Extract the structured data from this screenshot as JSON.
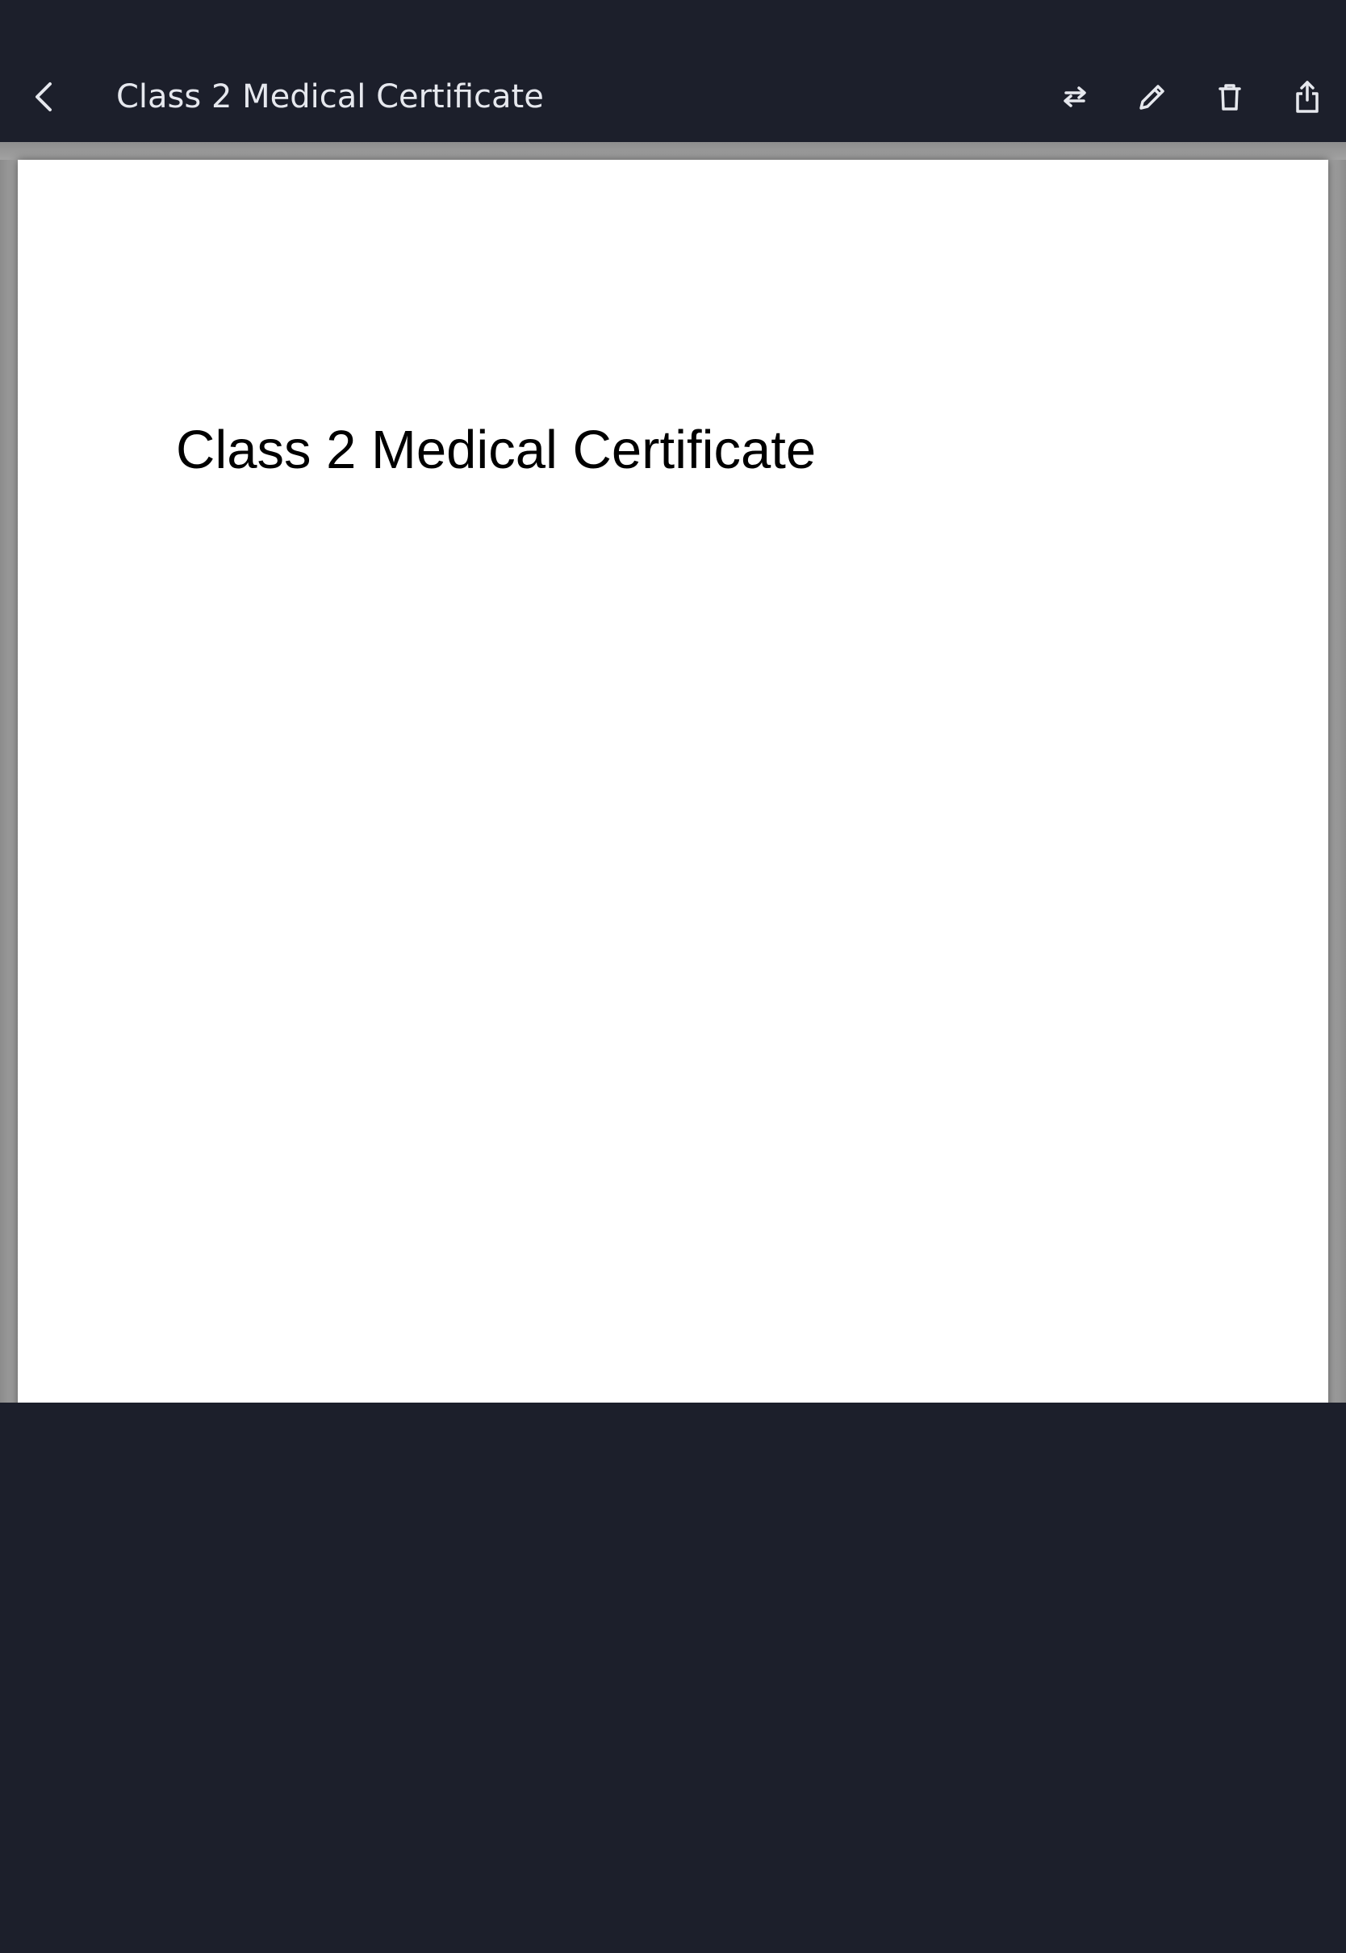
{
  "app_bar": {
    "title": "Class 2 Medical Certificate",
    "back_icon": "chevron-left-icon",
    "actions": [
      {
        "name": "swap-button",
        "icon": "swap-arrows-icon"
      },
      {
        "name": "edit-button",
        "icon": "pencil-icon"
      },
      {
        "name": "delete-button",
        "icon": "trash-icon"
      },
      {
        "name": "share-button",
        "icon": "share-icon"
      }
    ]
  },
  "document": {
    "heading": "Class 2 Medical Certificate"
  },
  "colors": {
    "background": "#1c1f2b",
    "icon": "#e6e8ee",
    "page": "#ffffff"
  }
}
